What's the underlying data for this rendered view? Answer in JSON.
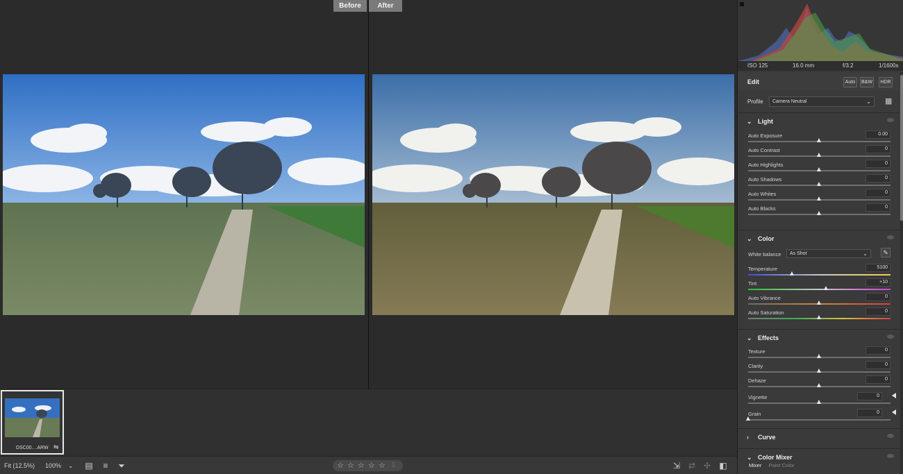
{
  "compare": {
    "before_label": "Before",
    "after_label": "After"
  },
  "filmstrip": {
    "thumb_name": "DSC00....ARW"
  },
  "bottom_bar": {
    "fit_label": "Fit (12.5%)",
    "zoom_value": "100%",
    "rating_stars": 0
  },
  "exif": {
    "iso": "ISO 125",
    "focal": "16.0 mm",
    "aperture": "f/3.2",
    "shutter": "1/1600s"
  },
  "edit": {
    "title": "Edit",
    "buttons": [
      "Auto",
      "B&W",
      "HDR"
    ],
    "profile_label": "Profile",
    "profile_value": "Camera Neutral"
  },
  "light": {
    "title": "Light",
    "sliders": [
      {
        "label": "Auto Exposure",
        "value": "0.00",
        "pos": 0.5
      },
      {
        "label": "Auto Contrast",
        "value": "0",
        "pos": 0.5
      },
      {
        "label": "Auto Highlights",
        "value": "0",
        "pos": 0.5
      },
      {
        "label": "Auto Shadows",
        "value": "0",
        "pos": 0.5
      },
      {
        "label": "Auto Whites",
        "value": "0",
        "pos": 0.5
      },
      {
        "label": "Auto Blacks",
        "value": "0",
        "pos": 0.5
      }
    ]
  },
  "color": {
    "title": "Color",
    "wb_label": "White balance",
    "wb_value": "As Shot",
    "sliders": [
      {
        "label": "Temperature",
        "value": "5100",
        "pos": 0.31,
        "grad": "temp"
      },
      {
        "label": "Tint",
        "value": "+10",
        "pos": 0.55,
        "grad": "tint"
      },
      {
        "label": "Auto Vibrance",
        "value": "0",
        "pos": 0.5,
        "grad": "vib"
      },
      {
        "label": "Auto Saturation",
        "value": "0",
        "pos": 0.5,
        "grad": "sat"
      }
    ]
  },
  "effects": {
    "title": "Effects",
    "sliders": [
      {
        "label": "Texture",
        "value": "0",
        "pos": 0.5
      },
      {
        "label": "Clarity",
        "value": "0",
        "pos": 0.5
      },
      {
        "label": "Dehaze",
        "value": "0",
        "pos": 0.5
      },
      {
        "label": "Vignette",
        "value": "0",
        "pos": 0.5
      },
      {
        "label": "Grain",
        "value": "0",
        "pos": 0.0
      }
    ]
  },
  "curve": {
    "title": "Curve"
  },
  "color_mixer": {
    "title": "Color Mixer",
    "tabs": [
      "Mixer",
      "Point Color"
    ]
  },
  "colors": {
    "panel_bg": "#3a3a3a",
    "canvas_bg": "#2b2b2b",
    "accent_border": "#e8e8e8"
  }
}
